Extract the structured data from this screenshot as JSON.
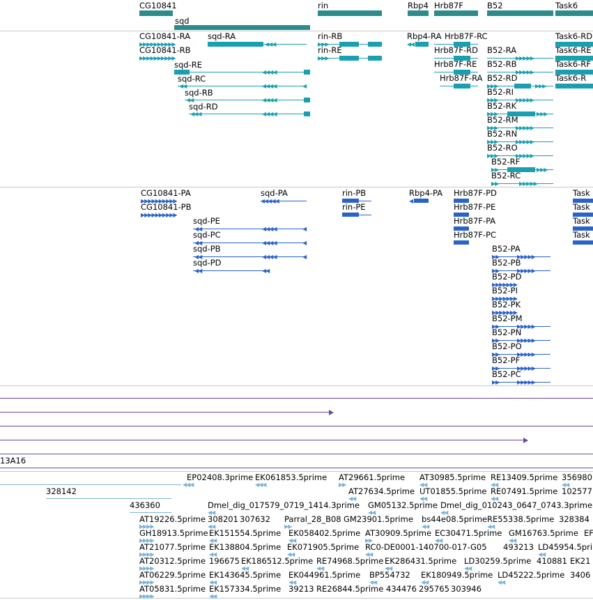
{
  "colors": {
    "gene": "#2e8b8b",
    "transcript": "#1a9fb0",
    "protein": "#2a62c9",
    "purple": "#6a4aa0",
    "est": "#7ab3d9",
    "divider": "#c8c8c8"
  },
  "genes_track": {
    "label_items": [
      {
        "text": "CG10841"
      },
      {
        "text": "sqd"
      },
      {
        "text": "rin"
      },
      {
        "text": "Rbp4"
      },
      {
        "text": "Hrb87F"
      },
      {
        "text": "B52"
      },
      {
        "text": "Task6"
      }
    ]
  },
  "transcripts_track": {
    "labels": [
      "CG10841-RA",
      "CG10841-RB",
      "sqd-RA",
      "sqd-RE",
      "sqd-RC",
      "sqd-RB",
      "sqd-RD",
      "rin-RB",
      "rin-RE",
      "Rbp4-RA",
      "Hrb87F-RC",
      "Hrb87F-RD",
      "Hrb87F-RE",
      "Hrb87F-RA",
      "B52-RA",
      "B52-RB",
      "B52-RD",
      "B52-RI",
      "B52-RK",
      "B52-RM",
      "B52-RN",
      "B52-RO",
      "B52-RF",
      "B52-RC",
      "Task6-RD",
      "Task6-RE",
      "Task6-RF",
      "Task6-R"
    ]
  },
  "proteins_track": {
    "labels": [
      "CG10841-PA",
      "CG10841-PB",
      "sqd-PA",
      "sqd-PE",
      "sqd-PC",
      "sqd-PB",
      "sqd-PD",
      "rin-PB",
      "rin-PE",
      "Rbp4-PA",
      "Hrb87F-PD",
      "Hrb87F-PE",
      "Hrb87F-PA",
      "Hrb87F-PC",
      "B52-PA",
      "B52-PB",
      "B52-PD",
      "B52-PI",
      "B52-PK",
      "B52-PM",
      "B52-PN",
      "B52-PO",
      "B52-PF",
      "B52-PC",
      "Task",
      "Task",
      "Task",
      "Task"
    ]
  },
  "clone_track": {
    "label": "13A16"
  },
  "est_track": {
    "labels": [
      "EP02408.3prime",
      "EK061853.5prime",
      "AT29661.5prime",
      "AT30985.5prime",
      "RE13409.5prime",
      "356980",
      "328142",
      "AT27634.5prime",
      "UT01855.5prime",
      "RE07491.5prime",
      "102577",
      "436360",
      "Dmel_dig_017579_0719_1414.3prime",
      "GM05132.5prime",
      "Dmel_dig_010243_0647_0743.3prime",
      "AT19226.5prime",
      "308201",
      "307632",
      "Parral_28_B08",
      "GM23901.5prime",
      "bs44e08.5prime",
      "RE55338.5prime",
      "328384",
      "GH18913.5prime",
      "EK151554.5prime",
      "EK058402.5prime",
      "AT30909.5prime",
      "EC30471.5prime",
      "GM16763.5prime",
      "EF",
      "AT21077.5prime",
      "EK138804.5prime",
      "EK071905.5prime",
      "RC0-DE0001-140700-017-G05",
      "493213",
      "LD45954.5prime",
      "AT20312.5prime",
      "196675",
      "EK186512.5prime",
      "RE74968.5prime",
      "EK286431.5prime",
      "LD30259.5prime",
      "410881",
      "EK21",
      "AT06229.5prime",
      "EK143645.5prime",
      "EK044961.5prime",
      "BP554732",
      "EK180949.5prime",
      "LD45222.5prime",
      "3406",
      "AT05831.5prime",
      "EK157334.5prime",
      "39213",
      "RE26844.5prime",
      "434476",
      "295765",
      "303946"
    ]
  }
}
